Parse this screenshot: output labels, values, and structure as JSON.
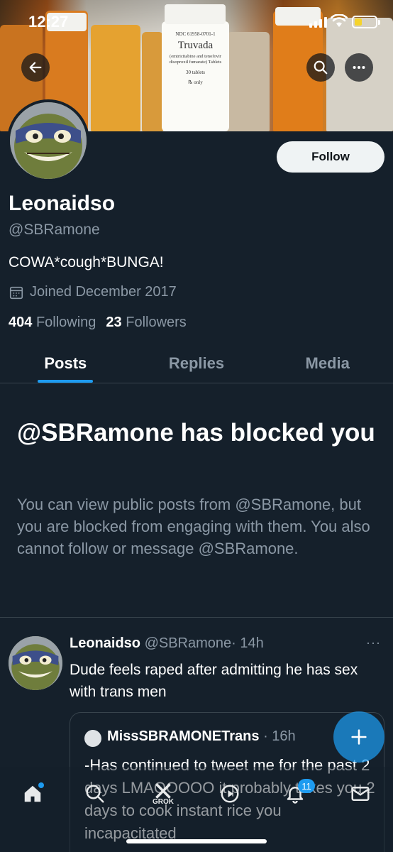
{
  "status_bar": {
    "time": "12:27"
  },
  "banner": {
    "label_ndc": "NDC 61958-0701-1",
    "label_name": "Truvada",
    "label_sub": "(emtricitabine and tenofovir disoproxil fumarate) Tablets",
    "label_count": "30 tablets",
    "label_rx": "℞ only"
  },
  "profile": {
    "follow_label": "Follow",
    "display_name": "Leonaidso",
    "handle": "@SBRamone",
    "bio": "COWA*cough*BUNGA!",
    "joined": "Joined December 2017",
    "following_count": "404",
    "following_label": "Following",
    "followers_count": "23",
    "followers_label": "Followers"
  },
  "tabs": [
    {
      "label": "Posts",
      "active": true
    },
    {
      "label": "Replies",
      "active": false
    },
    {
      "label": "Media",
      "active": false
    }
  ],
  "blocked": {
    "title": "@SBRamone has blocked you",
    "text": "You can view public posts from @SBRamone, but you are blocked from engaging with them. You also cannot follow or message @SBRamone."
  },
  "tweet": {
    "name": "Leonaidso",
    "handle": "@SBRamone",
    "time": "· 14h",
    "more": "···",
    "text": "Dude feels raped after admitting he has sex with trans men",
    "quote": {
      "name": "MissSBRAMONETrans",
      "time": "· 16h",
      "text": "-Has continued to tweet me for the past 2 days LMAOOOOO it probably takes you 2 days to cook instant rice you incapacitated"
    }
  },
  "bottom_nav": {
    "grok_label": "GROK",
    "notifications_badge": "11"
  },
  "colors": {
    "background": "#15202b",
    "accent": "#1d9bf0",
    "secondary_text": "#8b98a5"
  },
  "icons": [
    "back-arrow-icon",
    "search-icon",
    "more-icon",
    "calendar-icon",
    "home-icon",
    "grok-icon",
    "play-icon",
    "bell-icon",
    "mail-icon",
    "plus-icon"
  ]
}
